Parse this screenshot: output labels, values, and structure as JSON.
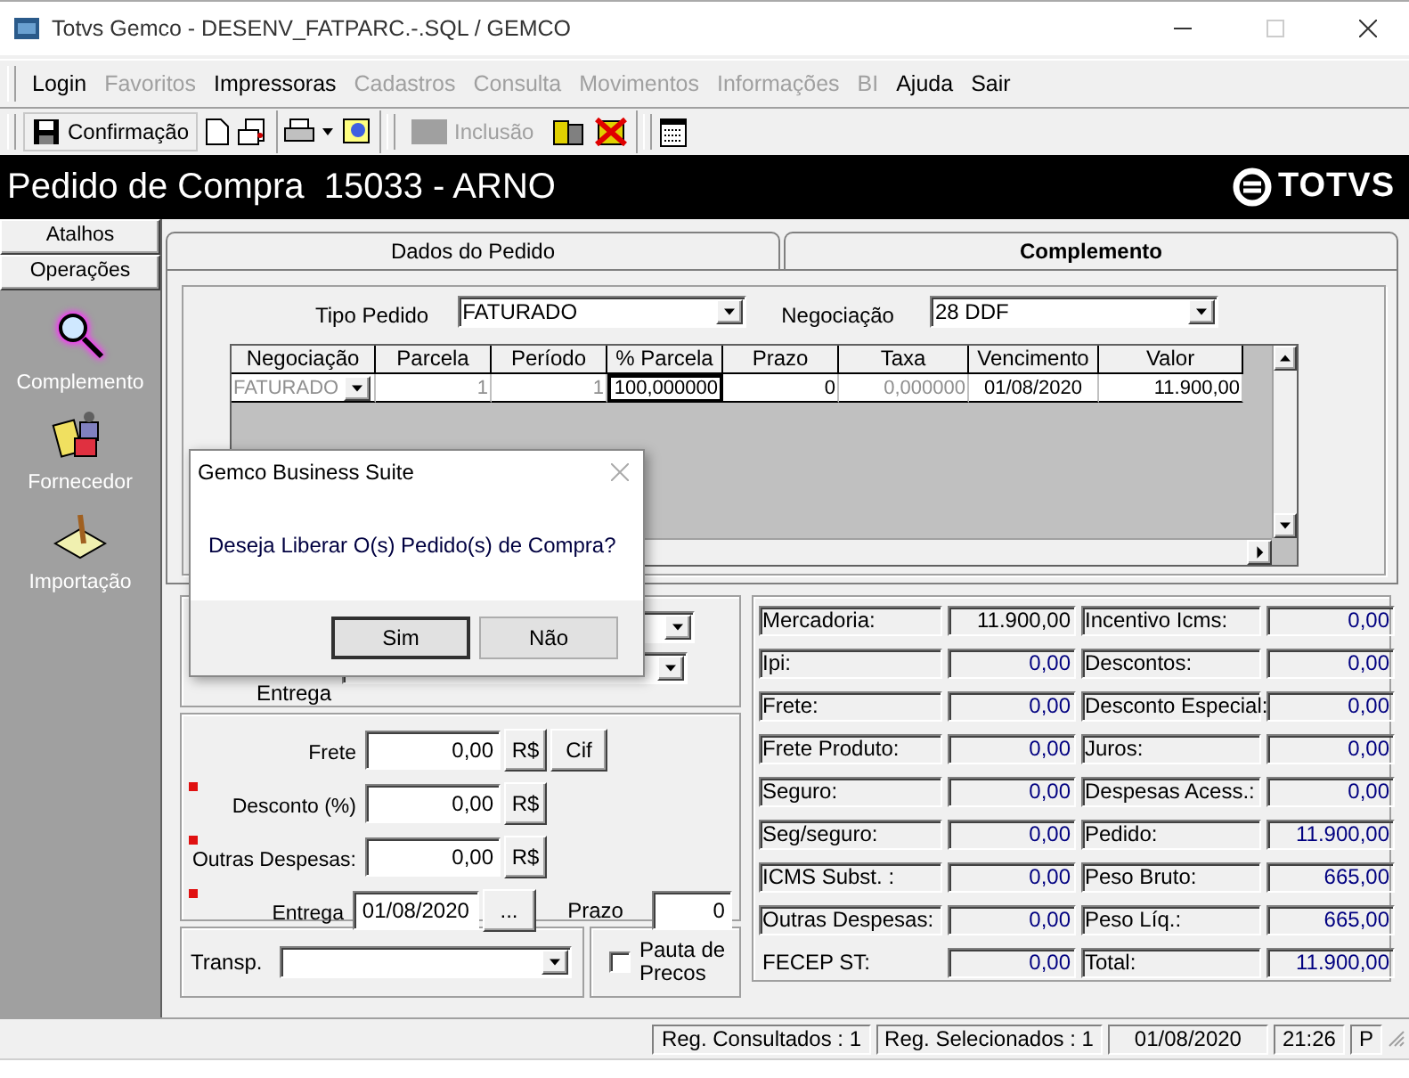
{
  "window": {
    "title": "Totvs Gemco - DESENV_FATPARC.-.SQL / GEMCO"
  },
  "menu": [
    {
      "label": "Login",
      "disabled": false
    },
    {
      "label": "Favoritos",
      "disabled": true
    },
    {
      "label": "Impressoras",
      "disabled": false
    },
    {
      "label": "Cadastros",
      "disabled": true
    },
    {
      "label": "Consulta",
      "disabled": true
    },
    {
      "label": "Movimentos",
      "disabled": true
    },
    {
      "label": "Informações",
      "disabled": true
    },
    {
      "label": "BI",
      "disabled": true
    },
    {
      "label": "Ajuda",
      "disabled": false
    },
    {
      "label": "Sair",
      "disabled": false
    }
  ],
  "toolbar": {
    "confirm": {
      "label": "Confirmação",
      "disabled": false
    },
    "include": {
      "label": "Inclusão",
      "disabled": true
    }
  },
  "header": {
    "title": "Pedido de Compra  15033 - ARNO",
    "logo": "TOTVS"
  },
  "sidebar": {
    "sections": [
      "Atalhos",
      "Operações"
    ],
    "items": [
      {
        "label": "Complemento",
        "selected": true
      },
      {
        "label": "Fornecedor",
        "selected": false
      },
      {
        "label": "Importação",
        "selected": false
      }
    ]
  },
  "tabs": [
    {
      "label": "Dados do Pedido",
      "selected": false
    },
    {
      "label": "Complemento",
      "selected": true
    }
  ],
  "order": {
    "type": {
      "label": "Tipo Pedido",
      "value": "FATURADO"
    },
    "negotiation": {
      "label": "Negociação",
      "value": "28 DDF"
    }
  },
  "grid": {
    "columns": [
      "Negociação",
      "Parcela",
      "Período",
      "% Parcela",
      "Prazo",
      "Taxa",
      "Vencimento",
      "Valor"
    ],
    "rows": [
      {
        "cells": [
          {
            "text": "FATURADO",
            "kind": "dropdown",
            "disabled": true,
            "focused": false
          },
          {
            "text": "1",
            "kind": "number",
            "disabled": true,
            "focused": false
          },
          {
            "text": "1",
            "kind": "number",
            "disabled": true,
            "focused": false
          },
          {
            "text": "100,000000",
            "kind": "number",
            "disabled": false,
            "focused": true
          },
          {
            "text": "0",
            "kind": "number",
            "disabled": false,
            "focused": false
          },
          {
            "text": "0,000000",
            "kind": "number",
            "disabled": true,
            "focused": false
          },
          {
            "text": "01/08/2020",
            "kind": "date",
            "disabled": false,
            "focused": false
          },
          {
            "text": "11.900,00",
            "kind": "number",
            "disabled": false,
            "focused": false
          }
        ]
      }
    ]
  },
  "hidden_panel": {
    "label": "Entrega"
  },
  "charges": [
    {
      "label": "Frete",
      "value": "0,00",
      "required": false,
      "buttons": [
        "R$",
        "Cif"
      ]
    },
    {
      "label": "Desconto (%)",
      "value": "0,00",
      "required": true,
      "buttons": [
        "R$"
      ]
    },
    {
      "label": "Outras Despesas:",
      "value": "0,00",
      "required": true,
      "buttons": [
        "R$"
      ]
    }
  ],
  "delivery": {
    "label": "Entrega",
    "value": "01/08/2020",
    "button": "...",
    "required": true,
    "term_label": "Prazo",
    "term_value": "0"
  },
  "transport": {
    "label": "Transp."
  },
  "price_list": {
    "label": "Pauta de Precos",
    "checked": false
  },
  "totals": [
    {
      "label": "Mercadoria:",
      "value": "11.900,00",
      "kind": "base",
      "boxed": true
    },
    {
      "label": "Incentivo Icms:",
      "value": "0,00",
      "kind": "computed",
      "boxed": true
    },
    {
      "label": "Ipi:",
      "value": "0,00",
      "kind": "computed",
      "boxed": true
    },
    {
      "label": "Descontos:",
      "value": "0,00",
      "kind": "computed",
      "boxed": true
    },
    {
      "label": "Frete:",
      "value": "0,00",
      "kind": "computed",
      "boxed": true
    },
    {
      "label": "Desconto Especial:",
      "value": "0,00",
      "kind": "computed",
      "boxed": true
    },
    {
      "label": "Frete Produto:",
      "value": "0,00",
      "kind": "computed",
      "boxed": true
    },
    {
      "label": "Juros:",
      "value": "0,00",
      "kind": "computed",
      "boxed": true
    },
    {
      "label": "Seguro:",
      "value": "0,00",
      "kind": "computed",
      "boxed": true
    },
    {
      "label": "Despesas Acess.:",
      "value": "0,00",
      "kind": "computed",
      "boxed": true
    },
    {
      "label": "Seg/seguro:",
      "value": "0,00",
      "kind": "computed",
      "boxed": true
    },
    {
      "label": "Pedido:",
      "value": "11.900,00",
      "kind": "computed",
      "boxed": true
    },
    {
      "label": "ICMS Subst. :",
      "value": "0,00",
      "kind": "computed",
      "boxed": true
    },
    {
      "label": "Peso Bruto:",
      "value": "665,00",
      "kind": "computed",
      "boxed": true
    },
    {
      "label": "Outras Despesas:",
      "value": "0,00",
      "kind": "computed",
      "boxed": true
    },
    {
      "label": "Peso Líq.:",
      "value": "665,00",
      "kind": "computed",
      "boxed": true
    },
    {
      "label": "FECEP ST:",
      "value": "0,00",
      "kind": "computed",
      "boxed": false
    },
    {
      "label": "Total:",
      "value": "11.900,00",
      "kind": "computed",
      "boxed": true
    }
  ],
  "dialog": {
    "title": "Gemco Business Suite",
    "message": "Deseja Liberar O(s) Pedido(s) de Compra?",
    "buttons": [
      {
        "label": "Sim",
        "default": true
      },
      {
        "label": "Não",
        "default": false
      }
    ]
  },
  "status_bar": [
    "Reg. Consultados : 1",
    "Reg. Selecionados : 1",
    "01/08/2020",
    "21:26",
    "P"
  ]
}
